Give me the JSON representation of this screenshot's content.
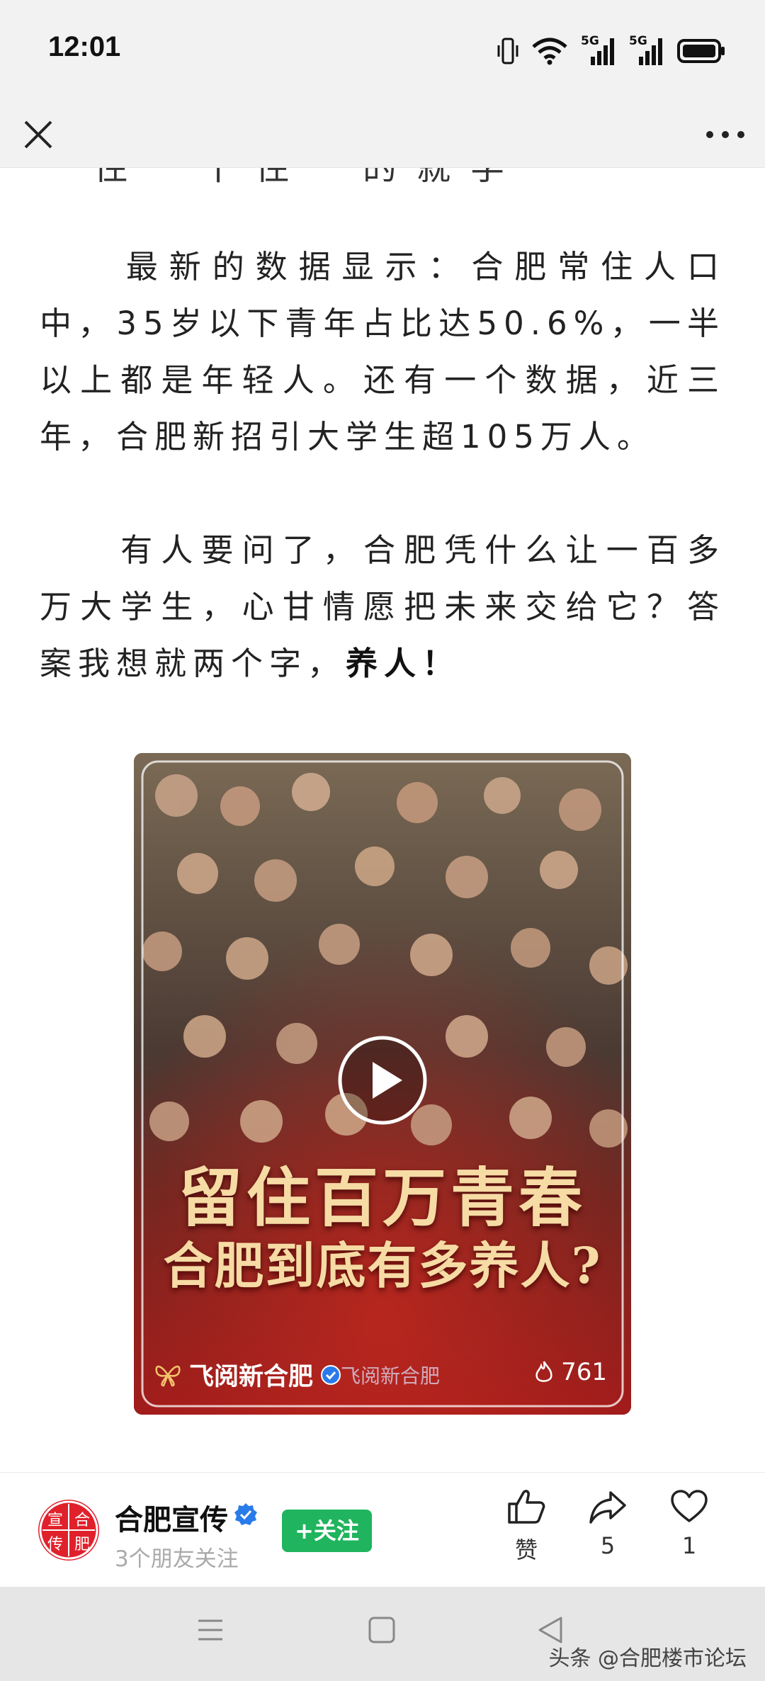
{
  "status_bar": {
    "time": "12:01",
    "icons": [
      "vibrate-icon",
      "wifi-icon",
      "signal-5g-icon",
      "signal-5g-icon",
      "battery-icon"
    ],
    "network_labels": [
      "5G",
      "5G"
    ]
  },
  "nav": {
    "icons": [
      "close-icon",
      "more-icon"
    ]
  },
  "article": {
    "cut_line": "一住一十住一的就学",
    "paragraph_1": "　　最新的数据显示：合肥常住人口中，35岁以下青年占比达50.6%，一半以上都是年轻人。还有一个数据，近三年，合肥新招引大学生超105万人。",
    "paragraph_2_prefix": "　　有人要问了，合肥凭什么让一百多万大学生，心甘情愿把未来交给它？答案我想就两个字，",
    "paragraph_2_bold": "养人！"
  },
  "video": {
    "title_line_1": "留住百万青春",
    "title_line_2": "合肥到底有多养人?",
    "source": "飞阅新合肥",
    "watermark": "飞阅新合肥",
    "views": "761",
    "icons": [
      "play-icon",
      "butterfly-logo-icon",
      "verified-icon",
      "flame-icon"
    ]
  },
  "author": {
    "name": "合肥宣传",
    "subtitle": "3个朋友关注",
    "follow_label": "+关注",
    "avatar_text": [
      "宣",
      "合",
      "传",
      "肥"
    ]
  },
  "actions": {
    "like_label": "赞",
    "share_count": "5",
    "favorite_count": "1",
    "icons": [
      "thumbs-up-icon",
      "share-icon",
      "heart-icon"
    ]
  },
  "system_nav": {
    "watermark": "头条 @合肥楼市论坛",
    "icons": [
      "menu-icon",
      "home-icon",
      "back-icon"
    ]
  },
  "colors": {
    "follow_green": "#1fb45d",
    "verified_blue": "#2a7bea",
    "avatar_red": "#e0212b",
    "title_gold": "#f6dba4"
  }
}
